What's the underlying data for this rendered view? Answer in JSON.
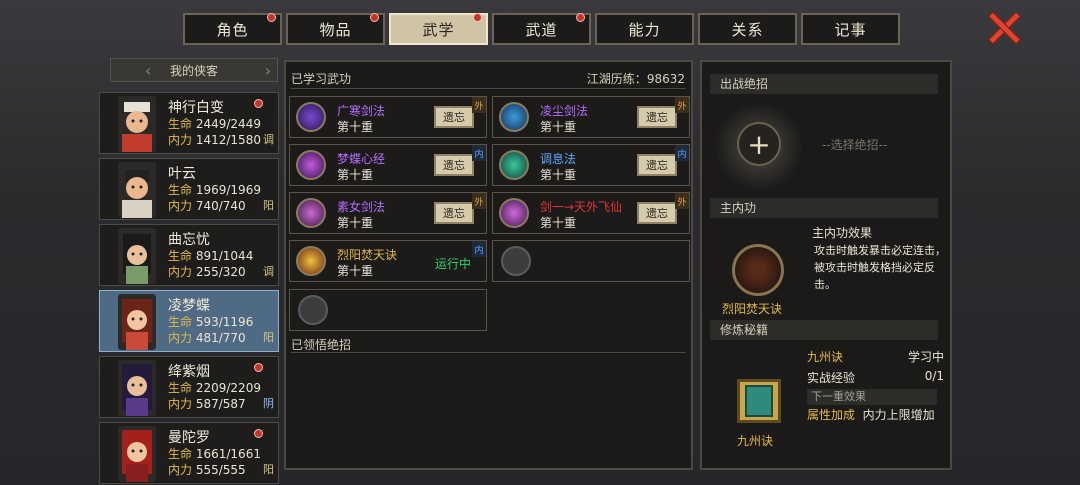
{
  "tabs": [
    {
      "label": "角色",
      "dot": true,
      "active": false
    },
    {
      "label": "物品",
      "dot": true,
      "active": false
    },
    {
      "label": "武学",
      "dot": true,
      "active": true
    },
    {
      "label": "武道",
      "dot": true,
      "active": false
    },
    {
      "label": "能力",
      "dot": false,
      "active": false
    },
    {
      "label": "关系",
      "dot": false,
      "active": false
    },
    {
      "label": "记事",
      "dot": false,
      "active": false
    }
  ],
  "roster": {
    "title": "我的侠客",
    "stat_labels": {
      "hp": "生命",
      "mp": "内力"
    },
    "members": [
      {
        "name": "神行白变",
        "hp": "2449/2449",
        "mp": "1412/1580",
        "tag": "调",
        "dot": true
      },
      {
        "name": "叶云",
        "hp": "1969/1969",
        "mp": "740/740",
        "tag": "阳",
        "dot": false
      },
      {
        "name": "曲忘忧",
        "hp": "891/1044",
        "mp": "255/320",
        "tag": "调",
        "dot": false
      },
      {
        "name": "凌梦蝶",
        "hp": "593/1196",
        "mp": "481/770",
        "tag": "阳",
        "dot": false,
        "selected": true
      },
      {
        "name": "绛紫烟",
        "hp": "2209/2209",
        "mp": "587/587",
        "tag": "阴",
        "dot": true
      },
      {
        "name": "曼陀罗",
        "hp": "1661/1661",
        "mp": "555/555",
        "tag": "阳",
        "dot": true
      }
    ]
  },
  "learned": {
    "title": "已学习武功",
    "exp_label": "江湖历练",
    "exp_value": "98632",
    "forget_label": "遗忘",
    "running_label": "运行中",
    "skills": [
      {
        "name": "广寒剑法",
        "level": "第十重",
        "type": "外",
        "color": "#b56cff"
      },
      {
        "name": "凌尘剑法",
        "level": "第十重",
        "type": "外",
        "color": "#b56cff"
      },
      {
        "name": "梦蝶心经",
        "level": "第十重",
        "type": "内",
        "color": "#b56cff"
      },
      {
        "name": "调息法",
        "level": "第十重",
        "type": "内",
        "color": "#5aa8ff"
      },
      {
        "name": "素女剑法",
        "level": "第十重",
        "type": "外",
        "color": "#b56cff"
      },
      {
        "name": "剑一→天外飞仙",
        "level": "第十重",
        "type": "外",
        "color": "#e03535"
      },
      {
        "name": "烈阳焚天诀",
        "level": "第十重",
        "type": "内",
        "color": "#e3b94a",
        "running": true
      }
    ],
    "comprehended_title": "已领悟绝招"
  },
  "panel": {
    "ultimate_title": "出战绝招",
    "choose_label": "--选择绝招--",
    "main_title": "主内功",
    "main_skill": "烈阳焚天诀",
    "effect_title": "主内功效果",
    "effect_text": "攻击时触发暴击必定连击，被攻击时触发格挡必定反击。",
    "cultivation_title": "修炼秘籍",
    "book_name": "九州诀",
    "book_status": "学习中",
    "exp_label": "实战经验",
    "exp_value": "0/1",
    "next_title": "下一重效果",
    "attr_label": "属性加成",
    "attr_text": "内力上限增加"
  }
}
